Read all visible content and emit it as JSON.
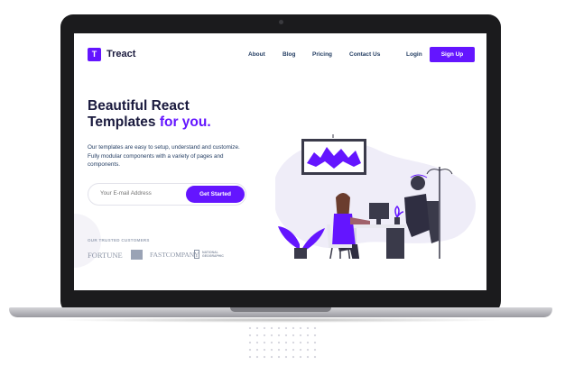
{
  "nav": {
    "logo_mark": "T",
    "logo_text": "Treact",
    "links": [
      "About",
      "Blog",
      "Pricing",
      "Contact Us"
    ],
    "login": "Login",
    "signup": "Sign Up"
  },
  "hero": {
    "headline_line1": "Beautiful React",
    "headline_line2": "Templates ",
    "headline_accent": "for you.",
    "description": "Our templates are easy to setup, understand and customize. Fully modular components with a variety of pages and components.",
    "email_placeholder": "Your E-mail Address",
    "cta": "Get Started"
  },
  "customers": {
    "heading": "OUR TRUSTED CUSTOMERS",
    "brands": [
      "FORTUNE",
      "FASTCOMPANY",
      "NATIONAL",
      "GEOGRAPHIC"
    ]
  },
  "colors": {
    "accent": "#6415ff",
    "heading": "#1a1a3e",
    "text": "#243e63"
  }
}
